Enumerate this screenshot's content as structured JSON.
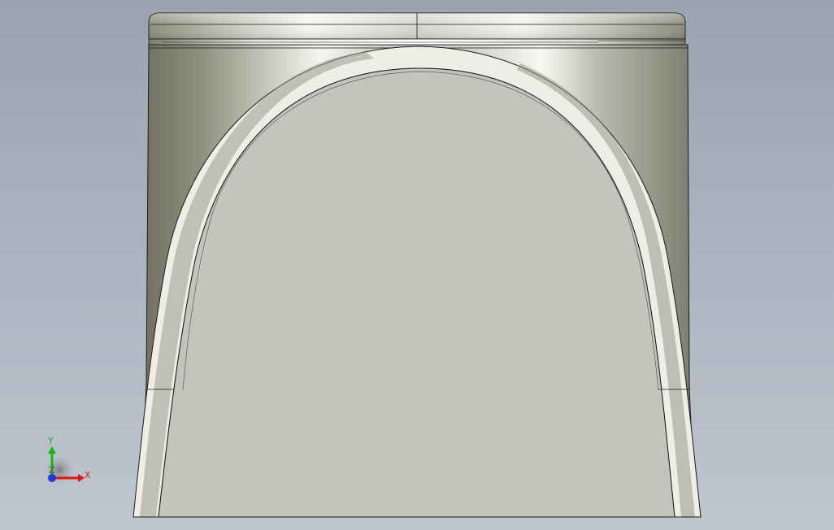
{
  "viewport": {
    "background_top": "#9aa3b1",
    "background_bottom": "#c0c6cf"
  },
  "model": {
    "metal_dark": "#6e6f60",
    "metal_mid": "#b4b5a8",
    "metal_light": "#f3f3ec",
    "face_color": "#c4c4bc",
    "edge_color": "#1b1b1b"
  },
  "triad": {
    "x_label": "X",
    "y_label": "Y",
    "z_label": "Z",
    "x_color": "#e01818",
    "y_color": "#18b418",
    "z_color": "#1a3bd8"
  }
}
